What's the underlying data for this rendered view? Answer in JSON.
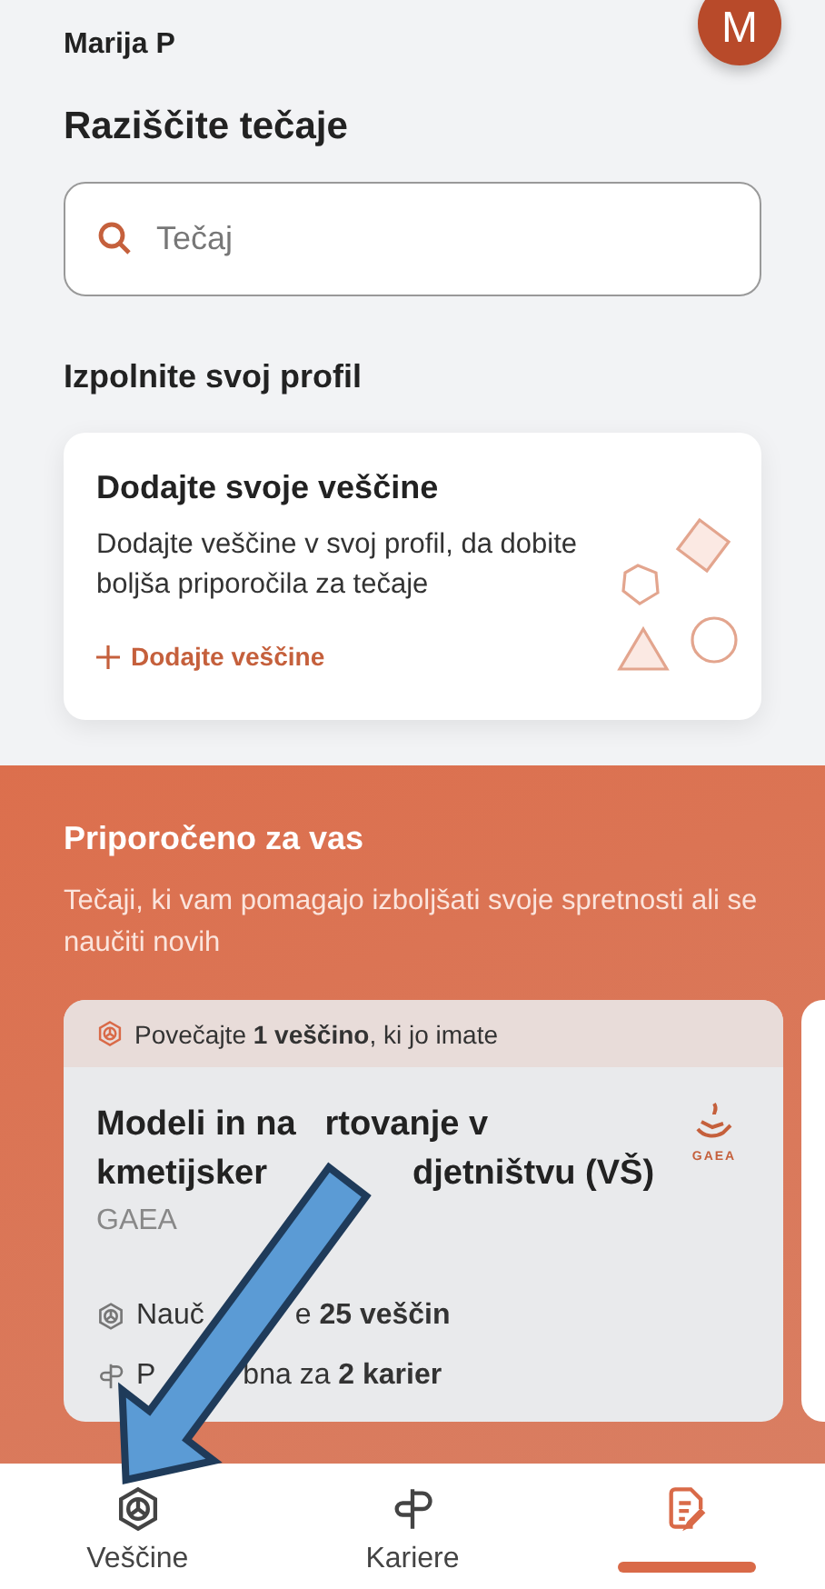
{
  "header": {
    "user_name": "Marija P",
    "avatar_initial": "M"
  },
  "explore": {
    "title": "Raziščite tečaje",
    "search": {
      "placeholder": "Tečaj"
    }
  },
  "profile": {
    "title": "Izpolnite svoj profil",
    "card": {
      "title": "Dodajte svoje veščine",
      "text": "Dodajte veščine v svoj profil, da dobite boljša priporočila za tečaje",
      "action": "Dodajte veščine"
    }
  },
  "recommended": {
    "title": "Priporočeno za vas",
    "subtitle": "Tečaji, ki vam pomagajo izboljšati svoje spretnosti ali se naučiti novih",
    "courses": [
      {
        "banner": "Povečajte **1 veščino**, ki jo imate",
        "title_lines": [
          [
            "Modeli in na",
            "rtovanje v"
          ],
          [
            "kmetijsker",
            "djetništvu (VŠ)"
          ]
        ],
        "provider": "GAEA",
        "logo_text": "GAEA",
        "skills": [
          "Nauč",
          "e **25 veščin**"
        ],
        "careers": [
          "P",
          "bna za **2 karier**"
        ]
      }
    ]
  },
  "nav": {
    "tabs": [
      {
        "kind": "skills",
        "label": "Veščine",
        "selected": false
      },
      {
        "kind": "careers",
        "label": "Kariere",
        "selected": false
      },
      {
        "kind": "document",
        "selected": true
      }
    ]
  },
  "annotations": [
    {
      "kind": "arrow"
    }
  ]
}
